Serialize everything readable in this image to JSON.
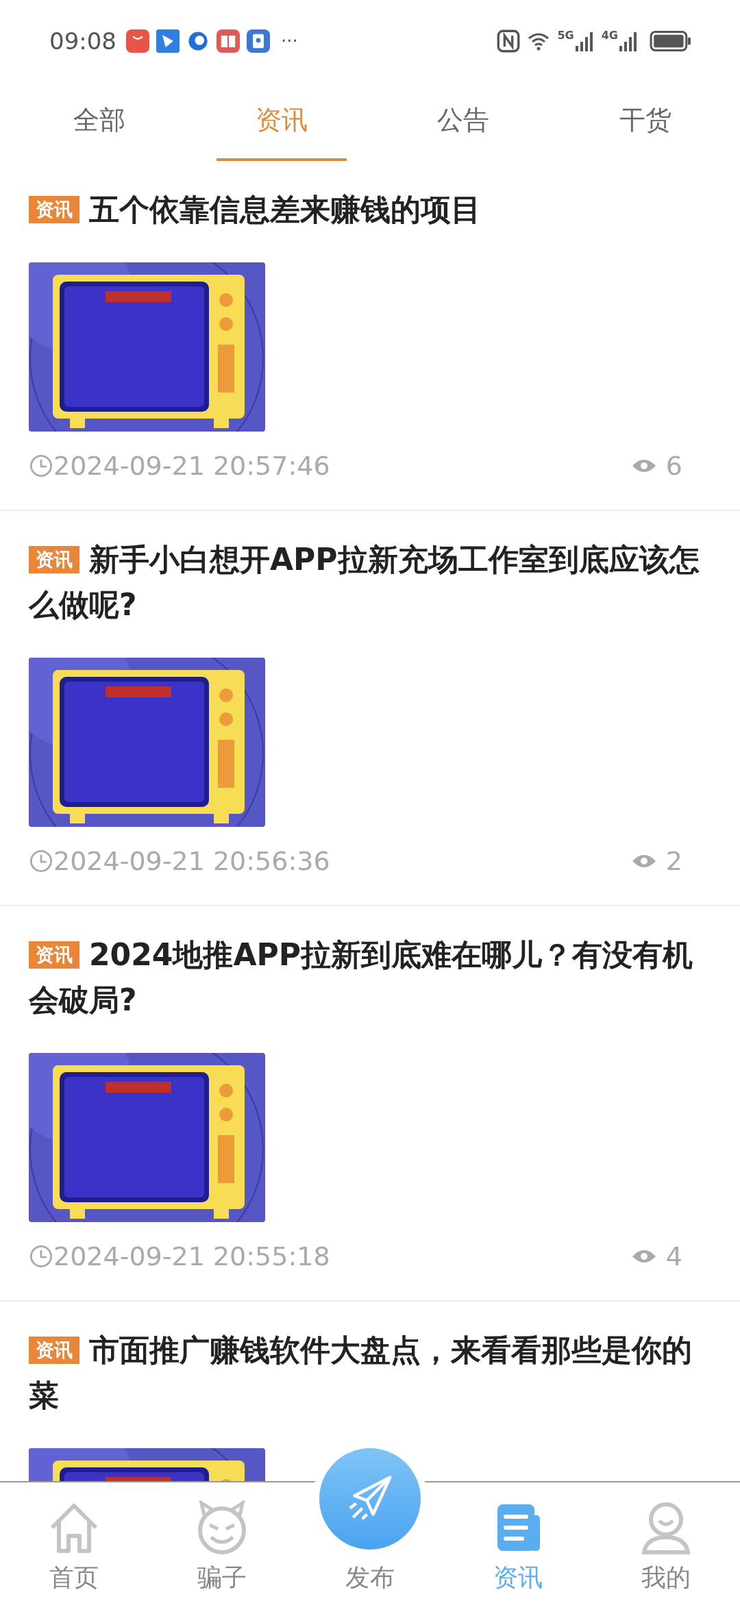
{
  "status_bar": {
    "time": "09:08",
    "more": "···",
    "network_1": "5G",
    "network_2": "4G"
  },
  "tabs": [
    {
      "label": "全部",
      "selected": false
    },
    {
      "label": "资讯",
      "selected": true
    },
    {
      "label": "公告",
      "selected": false
    },
    {
      "label": "干货",
      "selected": false
    }
  ],
  "articles": [
    {
      "tag": "资讯",
      "title": "五个依靠信息差来赚钱的项目",
      "time": "2024-09-21 20:57:46",
      "views": "6"
    },
    {
      "tag": "资讯",
      "title": "新手小白想开APP拉新充场工作室到底应该怎么做呢?",
      "time": "2024-09-21 20:56:36",
      "views": "2"
    },
    {
      "tag": "资讯",
      "title": "2024地推APP拉新到底难在哪儿？有没有机会破局?",
      "time": "2024-09-21 20:55:18",
      "views": "4"
    },
    {
      "tag": "资讯",
      "title": "市面推广赚钱软件大盘点，来看看那些是你的菜"
    }
  ],
  "bottom_nav": [
    {
      "kind": "home",
      "label": "首页",
      "selected": false
    },
    {
      "kind": "devil",
      "label": "骗子",
      "selected": false
    },
    {
      "kind": "publish",
      "label": "发布",
      "selected": false
    },
    {
      "kind": "news",
      "label": "资讯",
      "selected": true
    },
    {
      "kind": "profile",
      "label": "我的",
      "selected": false
    }
  ]
}
